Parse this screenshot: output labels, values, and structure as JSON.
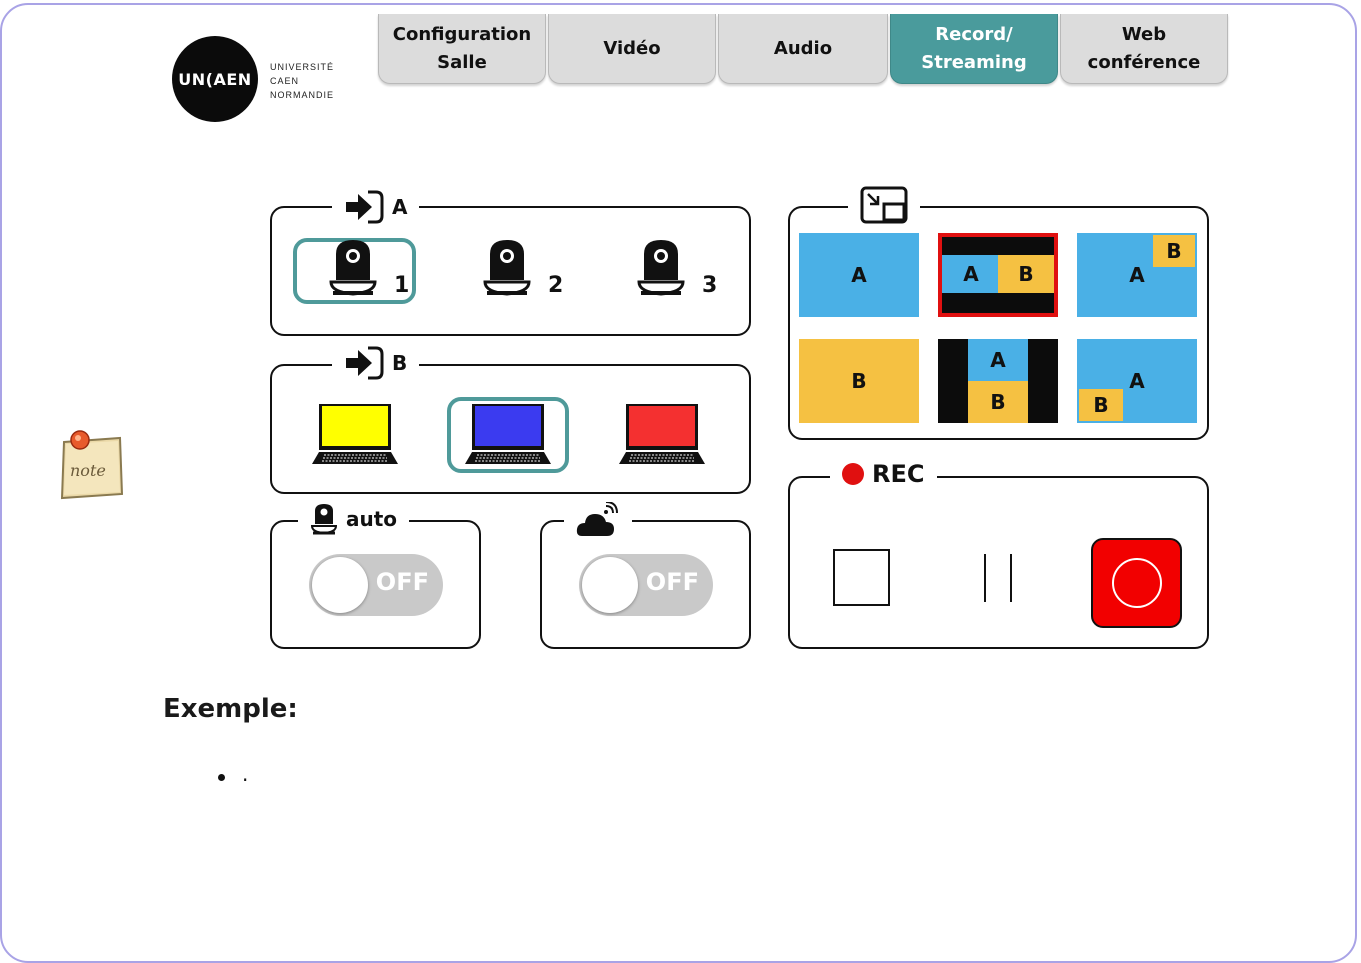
{
  "tabs": [
    {
      "label": "Configuration\nSalle"
    },
    {
      "label": "Vidéo"
    },
    {
      "label": "Audio"
    },
    {
      "label": "Record/\nStreaming"
    },
    {
      "label": "Web\nconférence"
    }
  ],
  "logo": {
    "mark": "UN(AEN",
    "university": "UNIVERSITÉ",
    "city": "CAEN",
    "region": "NORMANDIE"
  },
  "source_a": {
    "legend": "A",
    "cameras": [
      "1",
      "2",
      "3"
    ],
    "selected": "1"
  },
  "source_b": {
    "legend": "B",
    "laptop_colors": [
      "#ffff00",
      "#3b3bf0",
      "#f43030"
    ],
    "selected": 1
  },
  "auto": {
    "legend": "auto",
    "toggle": "OFF"
  },
  "stream": {
    "toggle": "OFF"
  },
  "layouts": {
    "labels": {
      "a": "A",
      "b": "B"
    },
    "selected": 1,
    "colors": {
      "a": "#4ab0e6",
      "b": "#f5c142",
      "frame": "#e01010"
    }
  },
  "rec": {
    "legend": "REC",
    "accent": "#e01010"
  },
  "content": {
    "heading": "Exemple:",
    "bullet": "."
  }
}
